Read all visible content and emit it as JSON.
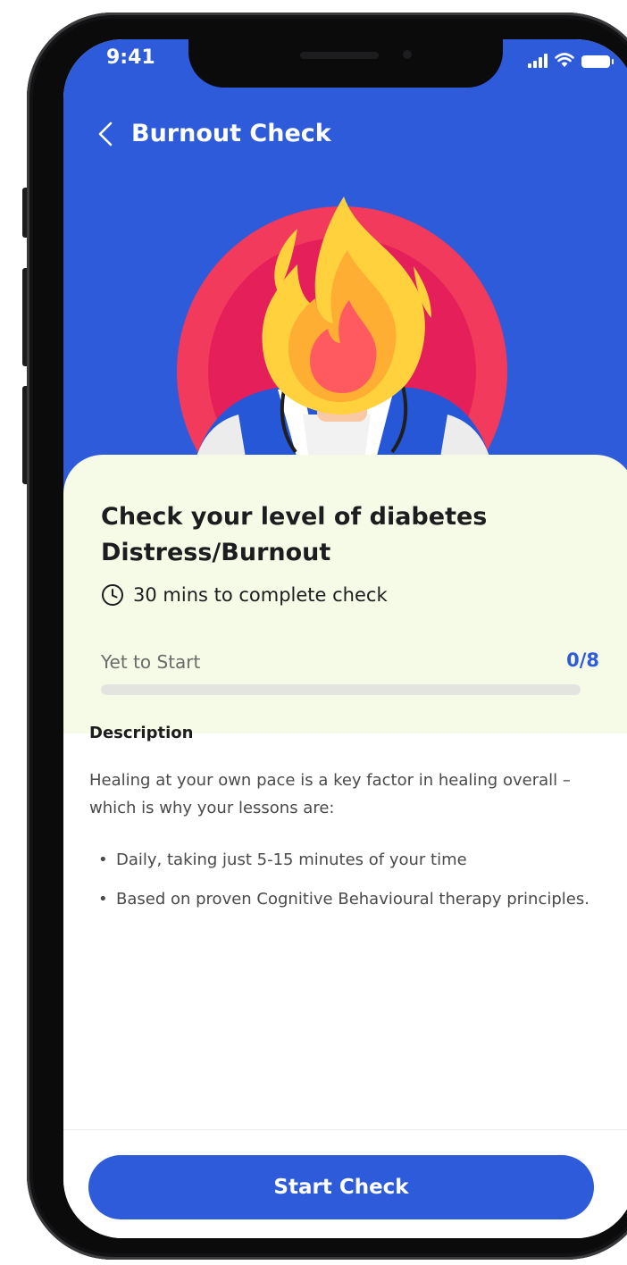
{
  "status_bar": {
    "time": "9:41"
  },
  "header": {
    "title": "Burnout Check",
    "back_icon": "chevron-left-icon"
  },
  "check": {
    "title": "Check your level of diabetes Distress/Burnout",
    "duration": "30 mins to complete check",
    "duration_icon": "clock-icon",
    "status": "Yet to Start",
    "progress_text": "0/8",
    "progress_fraction": 0
  },
  "description": {
    "heading": "Description",
    "body": "Healing at your own pace is a key factor in healing overall – which is why your lessons are:",
    "bullets": [
      "Daily, taking just 5-15 minutes of your time",
      "Based on proven Cognitive Behavioural therapy principles."
    ]
  },
  "footer": {
    "cta_label": "Start Check"
  },
  "colors": {
    "primary": "#2E5BDA",
    "card_background": "#F6FBE7",
    "flame_outer": "#FFD13C",
    "flame_inner": "#FF5A5F",
    "circle": "#F23A5C"
  }
}
